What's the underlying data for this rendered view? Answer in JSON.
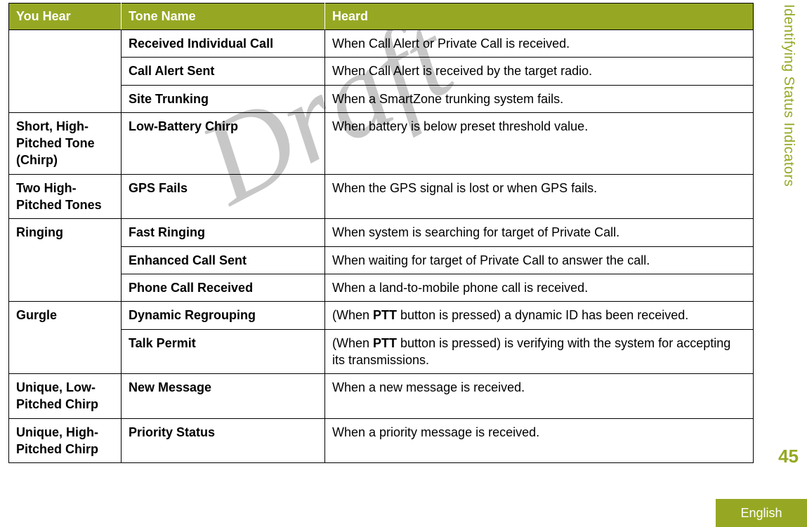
{
  "sideLabel": "Identifying Status Indicators",
  "pageNumber": "45",
  "language": "English",
  "watermark": "Draft",
  "table": {
    "headers": {
      "c1": "You Hear",
      "c2": "Tone Name",
      "c3": "Heard"
    },
    "rows": [
      {
        "youHear": "",
        "youHearRowspan": 3,
        "tone": "Received Individual Call",
        "heard": "When Call Alert or Private Call is received."
      },
      {
        "tone": "Call Alert Sent",
        "heard": "When Call Alert is received by the target radio."
      },
      {
        "tone": "Site Trunking",
        "heard": "When a SmartZone trunking system fails."
      },
      {
        "youHear": "Short, High-Pitched Tone (Chirp)",
        "tone": "Low-Battery Chirp",
        "heard": "When battery is below preset threshold value."
      },
      {
        "youHear": "Two High-Pitched Tones",
        "tone": "GPS Fails",
        "heard": "When the GPS signal is lost or when GPS fails."
      },
      {
        "youHear": "Ringing",
        "youHearRowspan": 3,
        "tone": "Fast Ringing",
        "heard": "When system is searching for target of Private Call."
      },
      {
        "tone": "Enhanced Call Sent",
        "heard": "When waiting for target of Private Call to answer the call."
      },
      {
        "tone": "Phone Call Received",
        "heard": "When a land-to-mobile phone call is received."
      },
      {
        "youHear": "Gurgle",
        "youHearRowspan": 2,
        "tone": "Dynamic Regrouping",
        "heardPrefix": "(When ",
        "heardBold": "PTT",
        "heardSuffix": " button is pressed) a dynamic ID has been received."
      },
      {
        "tone": "Talk Permit",
        "heardPrefix": "(When ",
        "heardBold": "PTT",
        "heardSuffix": " button is pressed) is verifying with the system for accepting its transmissions."
      },
      {
        "youHear": "Unique, Low-Pitched Chirp",
        "tone": "New Message",
        "heard": "When a new message is received."
      },
      {
        "youHear": "Unique, High-Pitched Chirp",
        "tone": "Priority Status",
        "heard": "When a priority message is received."
      }
    ]
  }
}
